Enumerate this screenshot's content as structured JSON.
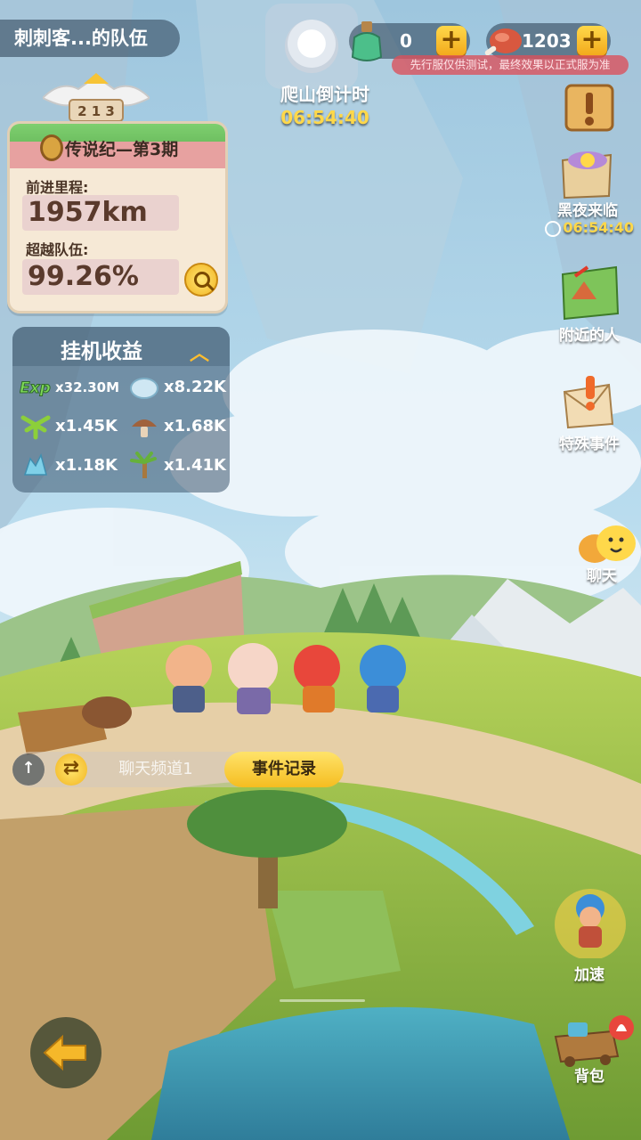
{
  "top_bar": {
    "team_name": "刺刺客...的队伍",
    "climb_label": "爬山倒计时",
    "climb_time": "06:54:40",
    "potion_count": "0",
    "meat_count": "1203",
    "plus_symbol": "+",
    "notice": "先行服仅供测试，最终效果以正式服为准"
  },
  "legend": {
    "rank_digits": "2 1 3",
    "title": "传说纪—第3期",
    "distance_label": "前进里程:",
    "distance_value": "1957km",
    "surpass_label": "超越队伍:",
    "surpass_value": "99.26%"
  },
  "idle": {
    "title": "挂机收益",
    "chevron": "︿",
    "items": [
      {
        "icon": "exp-icon",
        "value": "x32.30M"
      },
      {
        "icon": "stone-icon",
        "value": "x8.22K"
      },
      {
        "icon": "leaf-icon",
        "value": "x1.45K"
      },
      {
        "icon": "mushroom-icon",
        "value": "x1.68K"
      },
      {
        "icon": "crystal-icon",
        "value": "x1.18K"
      },
      {
        "icon": "palm-icon",
        "value": "x1.41K"
      }
    ]
  },
  "side": {
    "night_label": "黑夜来临",
    "night_time": "06:54:40",
    "nearby_label": "附近的人",
    "special_label": "特殊事件",
    "chat_label": "聊天",
    "speed_label": "加速",
    "bag_label": "背包"
  },
  "chat": {
    "up_arrow": "↑",
    "swap_symbol": "⇄",
    "channel": "聊天频道1",
    "event_log": "事件记录"
  },
  "colors": {
    "accent_gold": "#ffd84a",
    "panel_dark": "#3c556e",
    "legend_bg": "#f6e9d6"
  }
}
